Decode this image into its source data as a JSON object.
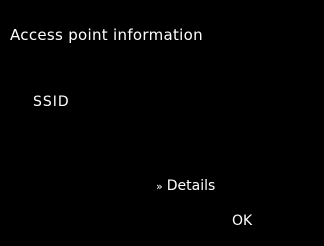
{
  "screen": {
    "title": "Access point information",
    "ssid_label": "SSID",
    "details_icon": "»",
    "details_label": "Details",
    "ok_label": "OK"
  },
  "colors": {
    "background": "#000000",
    "text": "#ffffff"
  }
}
